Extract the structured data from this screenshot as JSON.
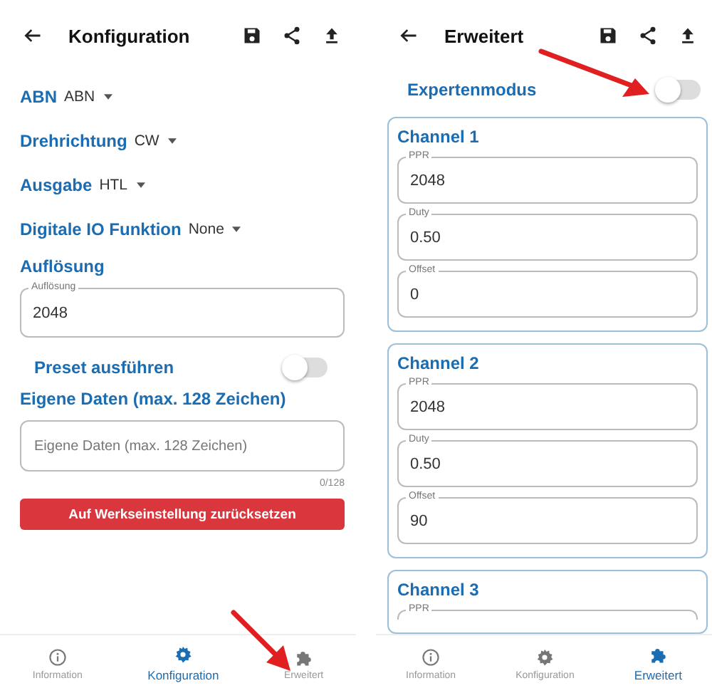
{
  "left_screen": {
    "title": "Konfiguration",
    "selects": [
      {
        "label": "ABN",
        "value": "ABN"
      },
      {
        "label": "Drehrichtung",
        "value": "CW"
      },
      {
        "label": "Ausgabe",
        "value": "HTL"
      },
      {
        "label": "Digitale IO Funktion",
        "value": "None"
      }
    ],
    "resolution": {
      "heading": "Auflösung",
      "field_label": "Auflösung",
      "value": "2048"
    },
    "preset": {
      "label": "Preset ausführen",
      "on": false
    },
    "custom_data": {
      "heading": "Eigene Daten (max. 128 Zeichen)",
      "placeholder": "Eigene Daten (max. 128 Zeichen)",
      "counter": "0/128"
    },
    "reset_button": "Auf Werkseinstellung zurücksetzen",
    "nav": [
      {
        "kind": "info",
        "label": "Information",
        "selected": false
      },
      {
        "kind": "gear",
        "label": "Konfiguration",
        "selected": true
      },
      {
        "kind": "puzzle",
        "label": "Erweitert",
        "selected": false
      }
    ]
  },
  "right_screen": {
    "title": "Erweitert",
    "expert_mode": {
      "label": "Expertenmodus",
      "on": false
    },
    "channels": [
      {
        "title": "Channel 1",
        "fields": [
          {
            "label": "PPR",
            "value": "2048"
          },
          {
            "label": "Duty",
            "value": "0.50"
          },
          {
            "label": "Offset",
            "value": "0"
          }
        ]
      },
      {
        "title": "Channel 2",
        "fields": [
          {
            "label": "PPR",
            "value": "2048"
          },
          {
            "label": "Duty",
            "value": "0.50"
          },
          {
            "label": "Offset",
            "value": "90"
          }
        ]
      },
      {
        "title": "Channel 3",
        "fields": [
          {
            "label": "PPR"
          }
        ]
      }
    ],
    "nav": [
      {
        "kind": "info",
        "label": "Information",
        "selected": false
      },
      {
        "kind": "gear",
        "label": "Konfiguration",
        "selected": false
      },
      {
        "kind": "puzzle",
        "label": "Erweitert",
        "selected": true
      }
    ]
  }
}
